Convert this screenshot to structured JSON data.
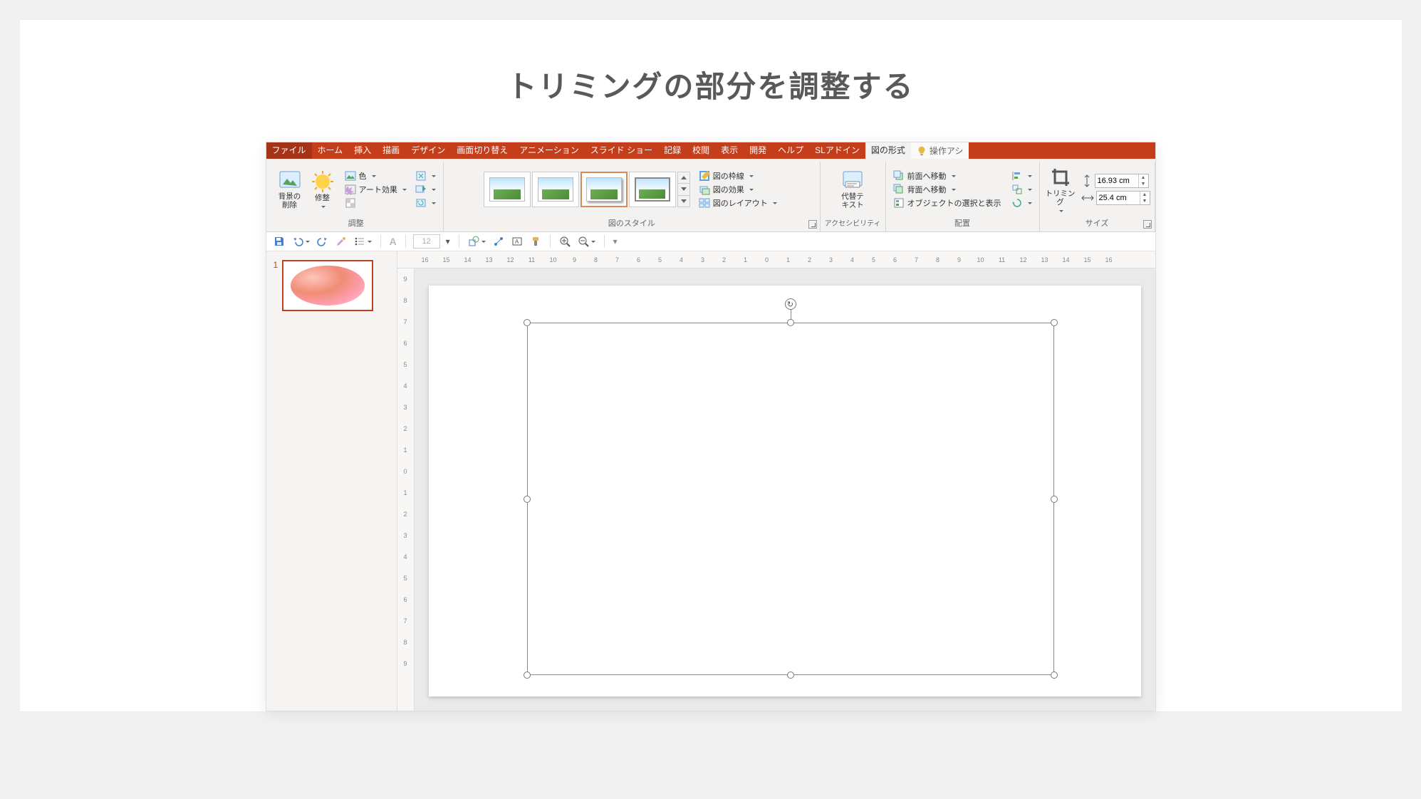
{
  "page": {
    "title": "トリミングの部分を調整する"
  },
  "tabs": {
    "file": "ファイル",
    "home": "ホーム",
    "insert": "挿入",
    "draw": "描画",
    "design": "デザイン",
    "transitions": "画面切り替え",
    "animations": "アニメーション",
    "slideshow": "スライド ショー",
    "record": "記録",
    "review": "校閲",
    "view": "表示",
    "developer": "開発",
    "help": "ヘルプ",
    "sl_addin": "SLアドイン",
    "picture_format": "図の形式",
    "tell_me": "操作アシ"
  },
  "ribbon": {
    "adjust_group": "調整",
    "remove_bg_1": "背景の",
    "remove_bg_2": "削除",
    "corrections": "修整",
    "color": "色",
    "artistic": "アート効果",
    "styles_group": "図のスタイル",
    "border": "図の枠線",
    "effects": "図の効果",
    "layout": "図のレイアウト",
    "acc_group": "アクセシビリティ",
    "alt_text_1": "代替テ",
    "alt_text_2": "キスト",
    "arrange_group": "配置",
    "bring_forward": "前面へ移動",
    "send_backward": "背面へ移動",
    "selection_pane": "オブジェクトの選択と表示",
    "size_group": "サイズ",
    "crop": "トリミング",
    "height_val": "16.93 cm",
    "width_val": "25.4 cm"
  },
  "qat": {
    "font_size": "12"
  },
  "thumbs": {
    "n1": "1"
  },
  "rulers": {
    "h": [
      "16",
      "15",
      "14",
      "13",
      "12",
      "11",
      "10",
      "9",
      "8",
      "7",
      "6",
      "5",
      "4",
      "3",
      "2",
      "1",
      "0",
      "1",
      "2",
      "3",
      "4",
      "5",
      "6",
      "7",
      "8",
      "9",
      "10",
      "11",
      "12",
      "13",
      "14",
      "15",
      "16"
    ],
    "v": [
      "9",
      "8",
      "7",
      "6",
      "5",
      "4",
      "3",
      "2",
      "1",
      "0",
      "1",
      "2",
      "3",
      "4",
      "5",
      "6",
      "7",
      "8",
      "9"
    ]
  }
}
